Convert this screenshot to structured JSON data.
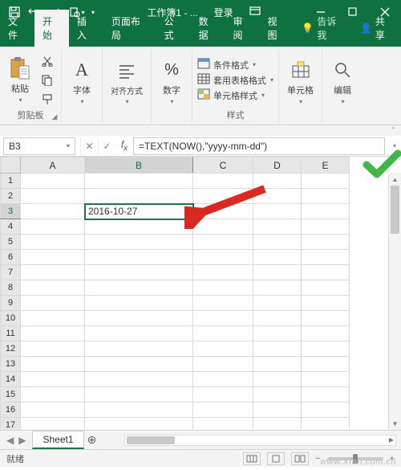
{
  "titlebar": {
    "doc_title": "工作簿1 - ...",
    "login": "登录"
  },
  "tabs": {
    "file": "文件",
    "home": "开始",
    "insert": "插入",
    "layout": "页面布局",
    "formulas": "公式",
    "data": "数据",
    "review": "审阅",
    "view": "视图",
    "tellme": "告诉我",
    "share": "共享"
  },
  "ribbon": {
    "paste": "粘贴",
    "clipboard": "剪贴板",
    "font": "字体",
    "alignment": "对齐方式",
    "number": "数字",
    "cond_format": "条件格式",
    "table_format": "套用表格格式",
    "cell_styles": "单元格样式",
    "styles": "样式",
    "cells": "单元格",
    "editing": "编辑"
  },
  "namebox": {
    "active": "B3"
  },
  "formula_bar": {
    "content": "=TEXT(NOW(),\"yyyy-mm-dd\")"
  },
  "chart_data": {
    "type": "table",
    "columns": [
      "A",
      "B",
      "C",
      "D",
      "E"
    ],
    "rows": 17,
    "selected_cell": "B3",
    "cells": {
      "B3": "2016-10-27"
    }
  },
  "sheet_tabs": {
    "active": "Sheet1"
  },
  "statusbar": {
    "ready": "就绪",
    "zoom": "100%"
  },
  "watermark": "www.Xfan.com.cn"
}
